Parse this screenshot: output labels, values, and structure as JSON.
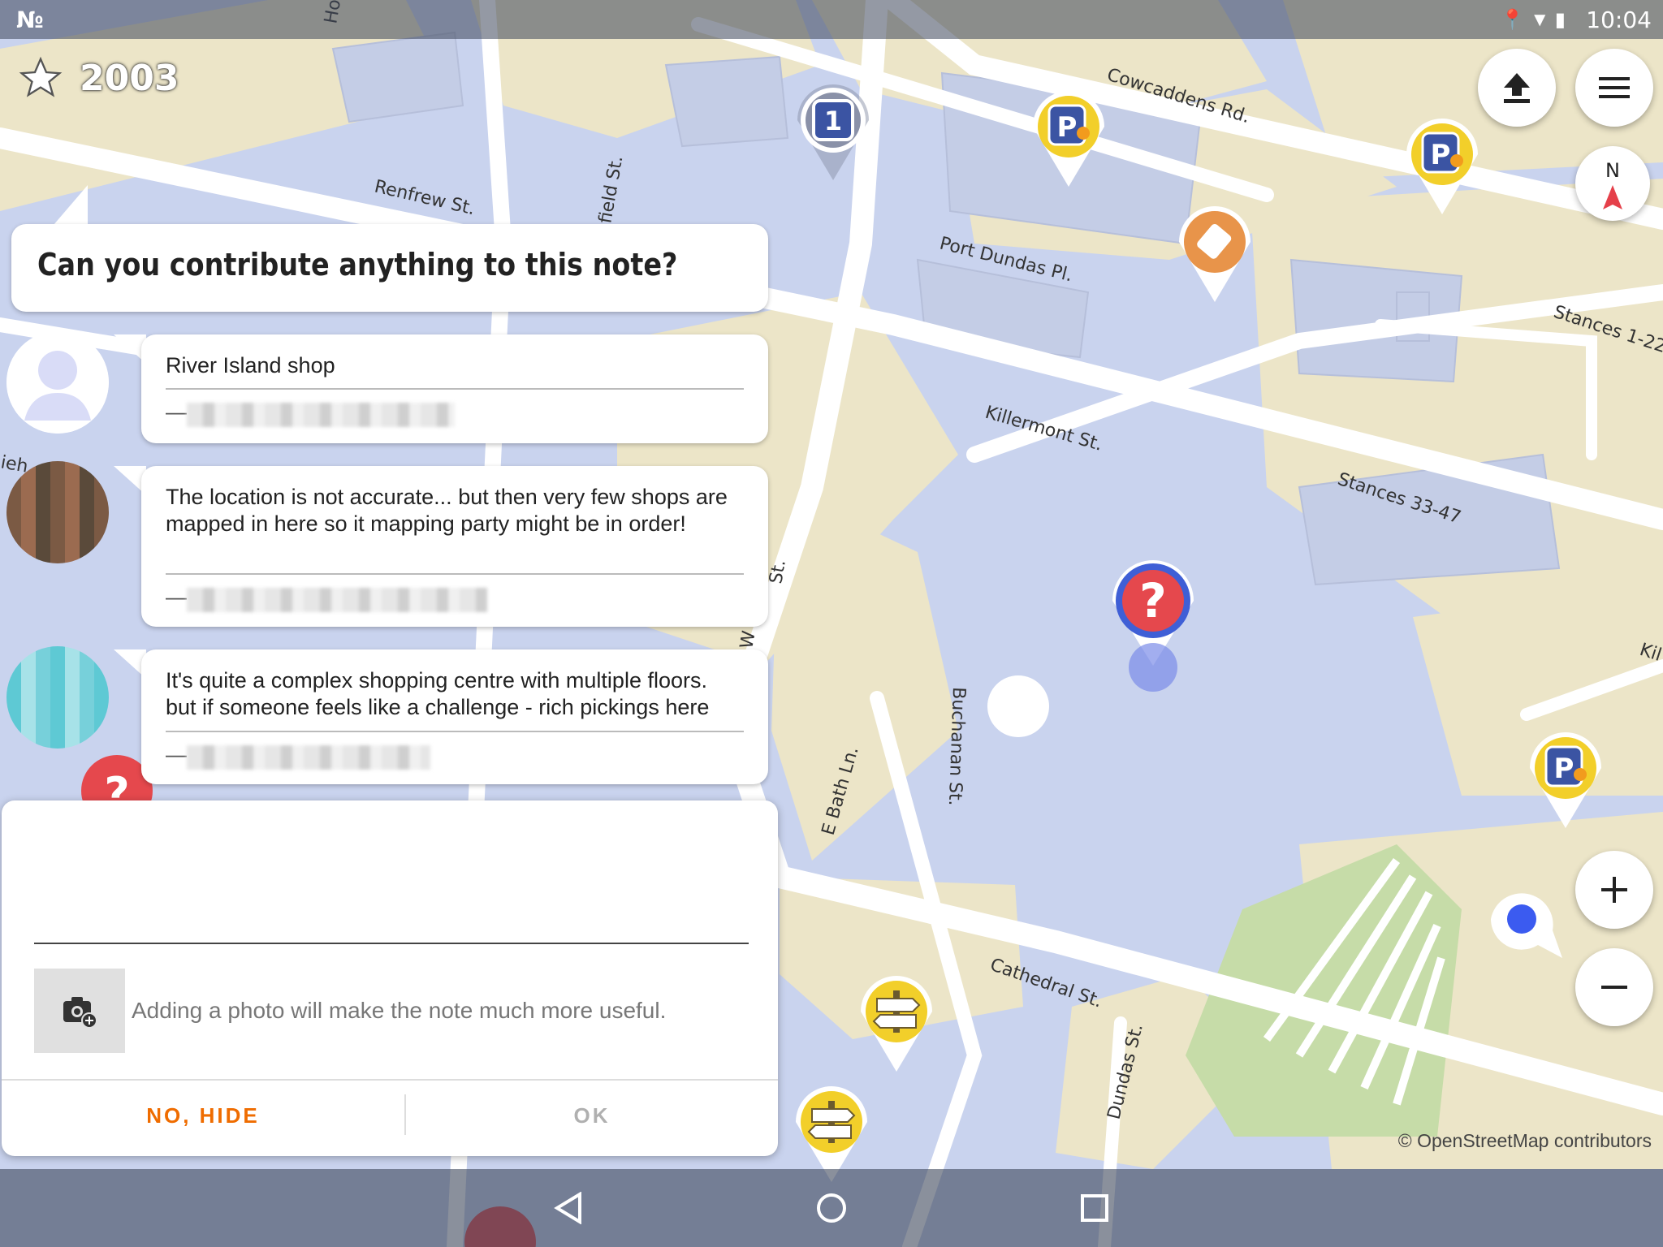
{
  "status_bar": {
    "time": "10:04"
  },
  "header": {
    "star_count": "2003"
  },
  "map": {
    "attribution": "© OpenStreetMap contributors",
    "road_labels": {
      "cowcaddens": "Cowcaddens Rd.",
      "renfrew": "Renfrew St.",
      "port_dundas": "Port Dundas Pl.",
      "killermont": "Killermont St.",
      "stances_1": "Stances 1-22",
      "stances_33": "Stances 33-47",
      "buchanan": "Buchanan St.",
      "e_bath": "E Bath Ln.",
      "cathedral": "Cathedral St.",
      "dundas": "Dundas St.",
      "field": "field St.",
      "hope": "Ho",
      "kil": "Kil",
      "w_st": "W",
      "st_frag": "St.",
      "ieh": "ieh"
    },
    "colors": {
      "water_blue": "#c9d3ee",
      "land_beige": "#ece5c8",
      "road": "#ffffff",
      "green": "#c6dca8"
    }
  },
  "note": {
    "question": "Can you contribute anything to this note?",
    "comments": [
      {
        "text": "River Island shop",
        "dash": "—"
      },
      {
        "text": "The location is not accurate... but then very few shops are mapped in here so it mapping party might be in order!",
        "dash": "—"
      },
      {
        "text": "It's quite a complex shopping centre with multiple floors. but if someone feels like a challenge - rich pickings here",
        "dash": "—"
      }
    ]
  },
  "dialog": {
    "input_value": "",
    "photo_hint": "Adding a photo will make the note much more useful.",
    "no_hide_label": "NO, HIDE",
    "ok_label": "OK",
    "accent": "#ef6c00",
    "disabled": "#b0b0b0"
  },
  "compass": {
    "label": "N"
  }
}
